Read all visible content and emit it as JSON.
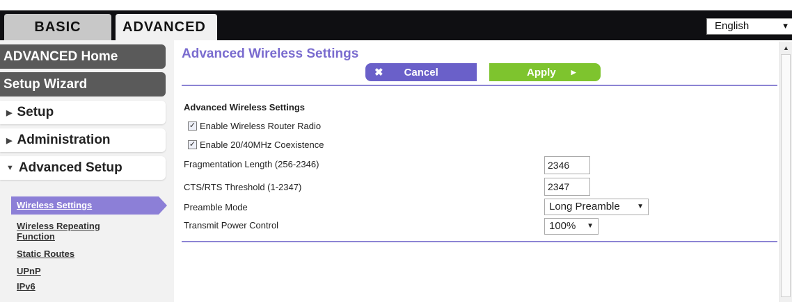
{
  "tabs": {
    "basic": "BASIC",
    "advanced": "ADVANCED"
  },
  "language": {
    "selected": "English"
  },
  "sidebar": {
    "home": "ADVANCED Home",
    "wizard": "Setup Wizard",
    "setup": "Setup",
    "administration": "Administration",
    "advanced_setup": "Advanced Setup",
    "subitems": [
      {
        "label": "Wireless Settings"
      },
      {
        "label": "Wireless Repeating"
      },
      {
        "label": "Function"
      },
      {
        "label": "Static Routes"
      },
      {
        "label": "UPnP"
      },
      {
        "label": "IPv6"
      }
    ]
  },
  "main": {
    "title": "Advanced Wireless Settings",
    "cancel": "Cancel",
    "apply": "Apply",
    "section": "Advanced Wireless Settings",
    "checkboxes": [
      {
        "label": "Enable Wireless Router Radio",
        "checked": true
      },
      {
        "label": "Enable 20/40MHz Coexistence",
        "checked": true
      }
    ],
    "fields": {
      "frag_label": "Fragmentation Length (256-2346)",
      "frag_value": "2346",
      "cts_label": "CTS/RTS Threshold (1-2347)",
      "cts_value": "2347",
      "preamble_label": "Preamble Mode",
      "preamble_value": "Long Preamble",
      "power_label": "Transmit Power Control",
      "power_value": "100%"
    }
  },
  "colors": {
    "accent": "#7a6ccf",
    "cancel": "#6a60c9",
    "apply": "#7ec42e",
    "active_nav": "#8c7fd7"
  }
}
